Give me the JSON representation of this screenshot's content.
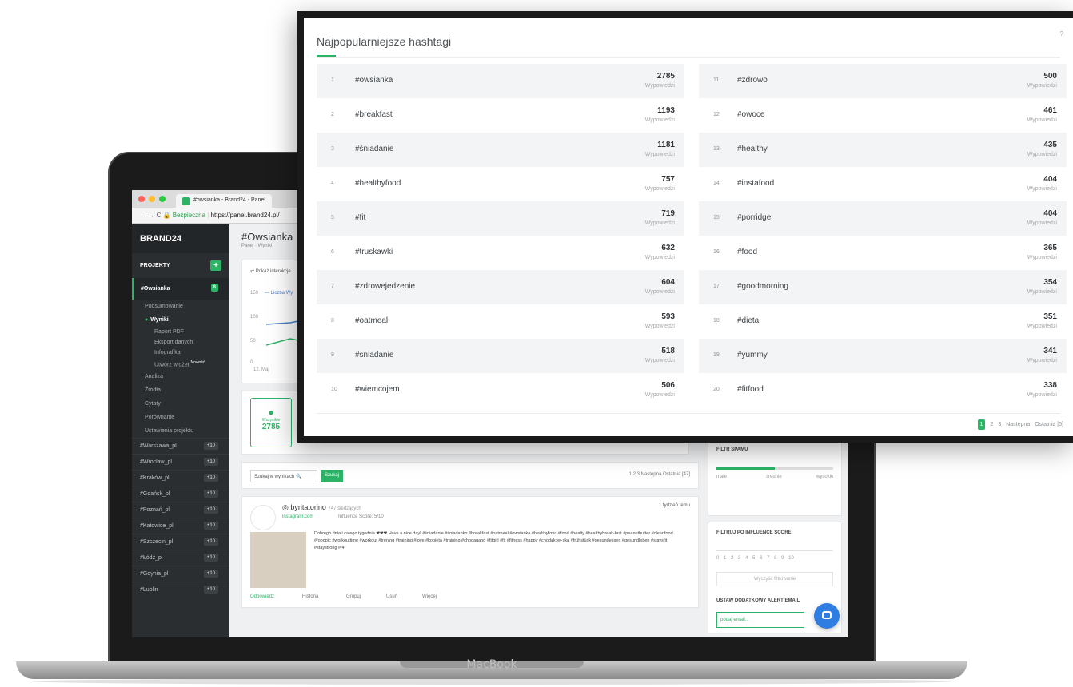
{
  "popup": {
    "title": "Najpopularniejsze hashtagi",
    "help": "?",
    "unit_label": "Wypowiedzi",
    "left": [
      {
        "rank": "1",
        "tag": "#owsianka",
        "count": "2785"
      },
      {
        "rank": "2",
        "tag": "#breakfast",
        "count": "1193"
      },
      {
        "rank": "3",
        "tag": "#śniadanie",
        "count": "1181"
      },
      {
        "rank": "4",
        "tag": "#healthyfood",
        "count": "757"
      },
      {
        "rank": "5",
        "tag": "#fit",
        "count": "719"
      },
      {
        "rank": "6",
        "tag": "#truskawki",
        "count": "632"
      },
      {
        "rank": "7",
        "tag": "#zdrowejedzenie",
        "count": "604"
      },
      {
        "rank": "8",
        "tag": "#oatmeal",
        "count": "593"
      },
      {
        "rank": "9",
        "tag": "#sniadanie",
        "count": "518"
      },
      {
        "rank": "10",
        "tag": "#wiemcojem",
        "count": "506"
      }
    ],
    "right": [
      {
        "rank": "11",
        "tag": "#zdrowo",
        "count": "500"
      },
      {
        "rank": "12",
        "tag": "#owoce",
        "count": "461"
      },
      {
        "rank": "13",
        "tag": "#healthy",
        "count": "435"
      },
      {
        "rank": "14",
        "tag": "#instafood",
        "count": "404"
      },
      {
        "rank": "15",
        "tag": "#porridge",
        "count": "404"
      },
      {
        "rank": "16",
        "tag": "#food",
        "count": "365"
      },
      {
        "rank": "17",
        "tag": "#goodmorning",
        "count": "354"
      },
      {
        "rank": "18",
        "tag": "#dieta",
        "count": "351"
      },
      {
        "rank": "19",
        "tag": "#yummy",
        "count": "341"
      },
      {
        "rank": "20",
        "tag": "#fitfood",
        "count": "338"
      }
    ],
    "pagination": {
      "p1": "1",
      "p2": "2",
      "p3": "3",
      "next": "Następna",
      "last": "Ostatnia [5]"
    }
  },
  "browser": {
    "tab_title": "#owsianka - Brand24 - Panel",
    "secure_label": "Bezpieczna",
    "url": "https://panel.brand24.pl/"
  },
  "sidebar": {
    "logo": "BRAND24",
    "projects_label": "PROJEKTY",
    "active_project": "#Owsianka",
    "active_count": "8",
    "menu": [
      "Podsumowanie",
      "Wyniki",
      "Analiza",
      "Źródła",
      "Cytaty",
      "Porównanie",
      "Ustawienia projektu"
    ],
    "submenu": [
      "Raport PDF",
      "Eksport danych",
      "Infografika",
      "Utwórz widżet"
    ],
    "widget_new_badge": "Nowość",
    "locations": [
      "#Warszawa_pl",
      "#Wroclaw_pl",
      "#Kraków_pl",
      "#Gdańsk_pl",
      "#Poznań_pl",
      "#Katowice_pl",
      "#Szczecin_pl",
      "#Łódź_pl",
      "#Gdynia_pl",
      "#Lublin"
    ],
    "location_badge": "+10"
  },
  "main": {
    "title": "#Owsianka",
    "breadcrumb": "Panel · Wyniki",
    "interactions_label": "Pokaż interakcje",
    "legend_label": "Liczba Wy",
    "y_ticks": [
      "150",
      "100",
      "50",
      "0"
    ],
    "x_tick": "12. Maj",
    "all_label": "Wszystkie",
    "all_count": "2785",
    "search_placeholder": "Szukaj w wynikach",
    "search_button": "Szukaj",
    "pager_mini": "1 2 3 Następna Ostatnia [47]",
    "mention": {
      "author": "byritatorino",
      "followers": "747 śledzących",
      "source": "instagram.com",
      "influence": "Influence Score: 5/10",
      "time": "1 tydzień temu",
      "text": "Dobrego dnia i całego tygodnia ❤❤❤ Have a nice day! #śniadanie #śniadanko #breakfast #oatmeal #owsianka #healthyfood #food #healty #healthybreak-fast #peanutbutter #cleanfood #foodpic #workouttime #workout #trening #training #love #kobieta #training #chodagang #fitgirl #fit #fitness #happy #chodakow-ska #frühstück #gesundessen #gesundleben #staysfit #staystrong #f4f",
      "actions": [
        "Odpowiedz",
        "Historia",
        "Grupuj",
        "Usuń",
        "Więcej"
      ]
    },
    "filters": {
      "spam_title": "FILTR SPAMU",
      "spam_levels": [
        "małe",
        "średnie",
        "wysokie"
      ],
      "influence_title": "FILTRUJ PO INFLUENCE SCORE",
      "influence_ticks": [
        "0",
        "1",
        "2",
        "3",
        "4",
        "5",
        "6",
        "7",
        "8",
        "9",
        "10"
      ],
      "clear_button": "Wyczyść filtrowanie",
      "alert_title": "USTAW DODATKOWY ALERT EMAIL",
      "email_placeholder": "podaj email..."
    }
  },
  "device_label": "MacBook"
}
